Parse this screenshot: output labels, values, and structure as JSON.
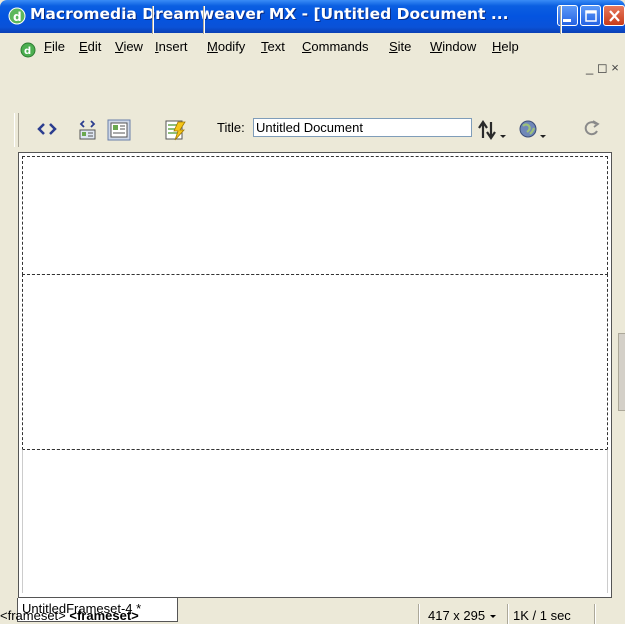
{
  "window": {
    "title": "Macromedia Dreamweaver MX - [Untitled Document ...",
    "icons": [
      "dreamweaver-icon",
      "minimize-icon",
      "maximize-icon",
      "close-icon"
    ]
  },
  "menu": {
    "items": [
      "File",
      "Edit",
      "View",
      "Insert",
      "Modify",
      "Text",
      "Commands",
      "Site",
      "Window",
      "Help"
    ],
    "mnemonics": [
      "F",
      "E",
      "V",
      "I",
      "M",
      "T",
      "C",
      "S",
      "W",
      "H"
    ],
    "mdi_controls": "_ ◻ ×"
  },
  "toolbar": {
    "icons": [
      "code-view-icon",
      "split-view-icon",
      "design-view-icon",
      "live-data-icon",
      "file-management-icon",
      "browser-preview-icon",
      "refresh-icon"
    ],
    "title_label": "Title:",
    "title_value": "Untitled Document"
  },
  "document": {
    "tab_label": "UntitledFrameset-4 *",
    "frames": [
      "top-frame",
      "middle-frame",
      "bottom-frame"
    ]
  },
  "status": {
    "tag_parent": "<frameset>",
    "tag_current": "<frameset>",
    "window_size": "417 x 295",
    "download": "1K / 1 sec"
  },
  "colors": {
    "titlebar": "#0454e0",
    "chrome": "#ece9d8",
    "close_button": "#c73c1a"
  }
}
